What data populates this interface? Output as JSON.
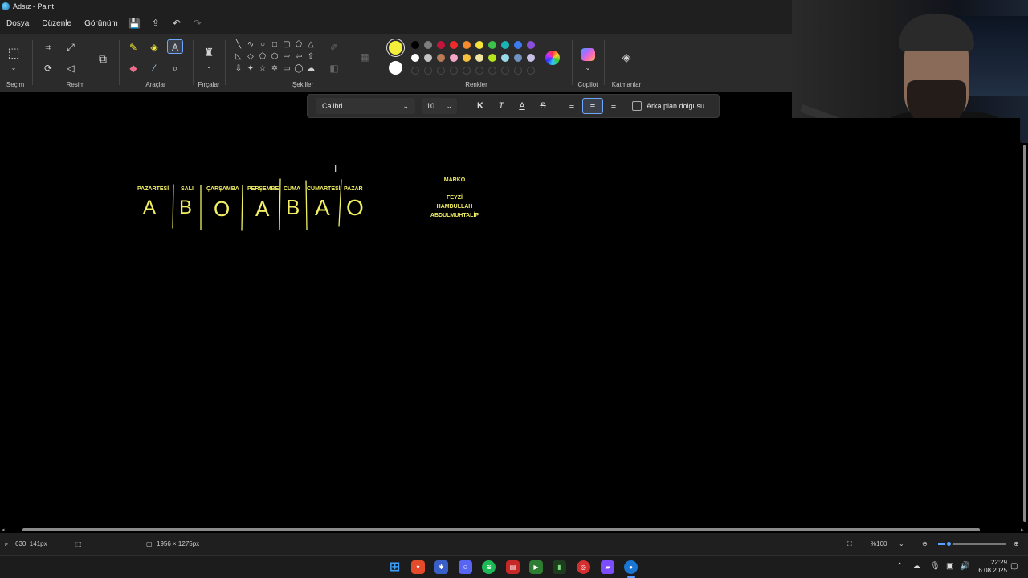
{
  "window": {
    "title": "Adsız - Paint"
  },
  "menu": {
    "file": "Dosya",
    "edit": "Düzenle",
    "view": "Görünüm"
  },
  "ribbon": {
    "selection": "Seçim",
    "image": "Resim",
    "tools": "Araçlar",
    "brushes": "Fırçalar",
    "shapes": "Şekiller",
    "colors": "Renkler",
    "copilot": "Copilot",
    "layers": "Katmanlar"
  },
  "palette": {
    "primary": "#f3ef3a",
    "secondary": "#ffffff",
    "row1": [
      "#000000",
      "#7f7f7f",
      "#c4143c",
      "#ef2b2b",
      "#f58b2c",
      "#f5e33a",
      "#3cc24b",
      "#19b4b4",
      "#3b7cf0",
      "#8a4fd8"
    ],
    "row2": [
      "#ffffff",
      "#c3c3c3",
      "#b97a57",
      "#f4a6c6",
      "#f5c13c",
      "#efe4a0",
      "#b5e61d",
      "#99d9ea",
      "#7092be",
      "#c8bfe7"
    ]
  },
  "text_toolbar": {
    "font": "Calibri",
    "size": "10",
    "bold": "K",
    "italic": "T",
    "underline": "A",
    "strike": "S",
    "background_fill": "Arka plan dolgusu"
  },
  "canvas": {
    "days": [
      "PAZARTESİ",
      "SALI",
      "ÇARŞAMBA",
      "PERŞEMBE",
      "CUMA",
      "CUMARTESİ",
      "PAZAR"
    ],
    "letters": [
      "A",
      "B",
      "O",
      "A",
      "B",
      "A",
      "O"
    ],
    "notes": {
      "top": "MARKO",
      "lines": [
        "FEYZİ",
        "HAMDULLAH",
        "ABDULMUHTALİP"
      ]
    }
  },
  "status": {
    "cursor_pos": "630, 141px",
    "image_size": "1956 × 1275px",
    "zoom": "%100",
    "zoom_slider_level": 0.16
  },
  "taskbar": {
    "time": "22:29",
    "date": "6.08.2025"
  }
}
